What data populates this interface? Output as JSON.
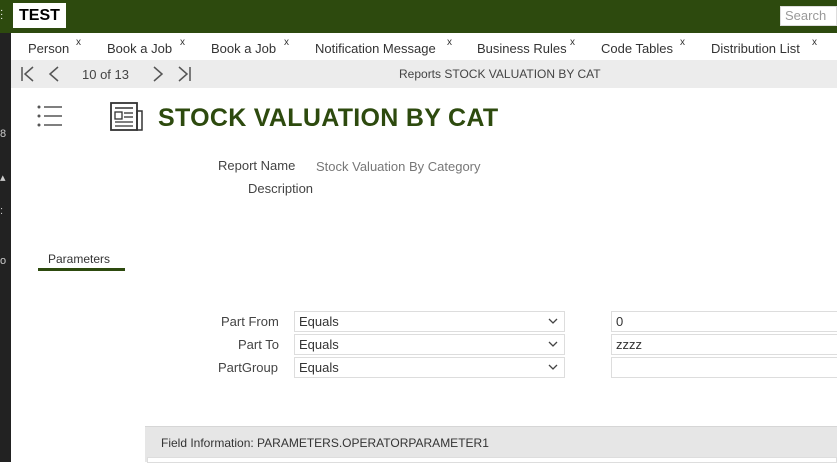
{
  "app": {
    "title": "TEST",
    "search_placeholder": "Search"
  },
  "tabs": [
    {
      "label": "Person",
      "close": "x"
    },
    {
      "label": "Book a Job",
      "close": "x"
    },
    {
      "label": "Book a Job",
      "close": "x"
    },
    {
      "label": "Notification Message",
      "close": "x"
    },
    {
      "label": "Business Rules",
      "close": "x"
    },
    {
      "label": "Code Tables",
      "close": "x"
    },
    {
      "label": "Distribution List",
      "close": "x"
    }
  ],
  "nav": {
    "counter": "10 of 13",
    "breadcrumb": "Reports STOCK VALUATION BY CAT"
  },
  "page": {
    "title": "STOCK VALUATION BY CAT"
  },
  "report": {
    "name_label": "Report Name",
    "name_value": "Stock Valuation By Category",
    "description_label": "Description"
  },
  "section_tab": "Parameters",
  "parameters": [
    {
      "label": "Part From",
      "operator": "Equals",
      "value": "0"
    },
    {
      "label": "Part To",
      "operator": "Equals",
      "value": "zzzz"
    },
    {
      "label": "PartGroup",
      "operator": "Equals",
      "value": ""
    }
  ],
  "field_info": {
    "title": "Field Information: PARAMETERS.OPERATORPARAMETER1"
  },
  "icons": {
    "first": "first-record-icon",
    "prev": "previous-record-icon",
    "next": "next-record-icon",
    "last": "last-record-icon",
    "menu": "list-menu-icon",
    "report": "report-document-icon",
    "dropdown": "chevron-down-icon"
  },
  "colors": {
    "brand": "#2d4a0e",
    "nav_bg": "#ececec",
    "field_info_bg": "#e6e6e6"
  }
}
